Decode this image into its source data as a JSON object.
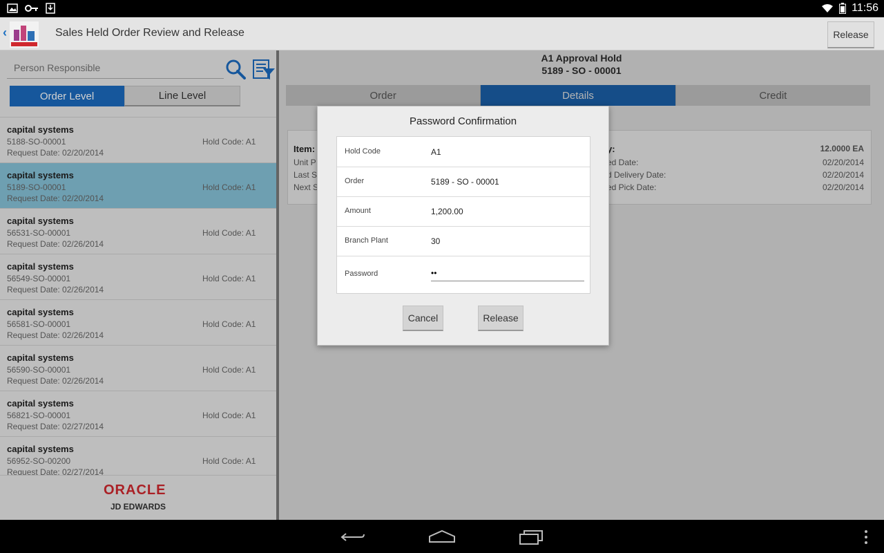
{
  "status_bar": {
    "time": "11:56"
  },
  "header": {
    "title": "Sales Held Order Review and Release",
    "release_label": "Release"
  },
  "left": {
    "search": {
      "placeholder": "Person Responsible",
      "value": ""
    },
    "segments": [
      {
        "label": "Order Level",
        "selected": true
      },
      {
        "label": "Line Level",
        "selected": false
      }
    ],
    "orders": [
      {
        "name": "capital systems",
        "order": "5188-SO-00001",
        "date": "Request Date: 02/20/2014",
        "hold": "Hold Code: A1"
      },
      {
        "name": "capital systems",
        "order": "5189-SO-00001",
        "date": "Request Date: 02/20/2014",
        "hold": "Hold Code: A1",
        "selected": true
      },
      {
        "name": "capital systems",
        "order": "56531-SO-00001",
        "date": "Request Date: 02/26/2014",
        "hold": "Hold Code: A1"
      },
      {
        "name": "capital systems",
        "order": "56549-SO-00001",
        "date": "Request Date: 02/26/2014",
        "hold": "Hold Code: A1"
      },
      {
        "name": "capital systems",
        "order": "56581-SO-00001",
        "date": "Request Date: 02/26/2014",
        "hold": "Hold Code: A1"
      },
      {
        "name": "capital systems",
        "order": "56590-SO-00001",
        "date": "Request Date: 02/26/2014",
        "hold": "Hold Code: A1"
      },
      {
        "name": "capital systems",
        "order": "56821-SO-00001",
        "date": "Request Date: 02/27/2014",
        "hold": "Hold Code: A1"
      },
      {
        "name": "capital systems",
        "order": "56952-SO-00200",
        "date": "Request Date: 02/27/2014",
        "hold": "Hold Code: A1"
      }
    ],
    "footer": {
      "brand": "ORACLE",
      "sub": "JD EDWARDS"
    }
  },
  "right": {
    "title_line1": "A1 Approval Hold",
    "title_line2": "5189 - SO - 00001",
    "tabs": [
      {
        "label": "Order"
      },
      {
        "label": "Details",
        "active": true
      },
      {
        "label": "Credit"
      }
    ],
    "card": {
      "item_label": "Item:",
      "unit_label": "Unit P",
      "last_label": "Last S",
      "next_label": "Next S",
      "qty_label": "y:",
      "qty_value": "12.0000 EA",
      "d1_label": "ed Date:",
      "d1_value": "02/20/2014",
      "d2_label": "d Delivery Date:",
      "d2_value": "02/20/2014",
      "d3_label": "ed Pick Date:",
      "d3_value": "02/20/2014"
    }
  },
  "dialog": {
    "title": "Password Confirmation",
    "fields": [
      {
        "label": "Hold Code",
        "value": "A1"
      },
      {
        "label": "Order",
        "value": "5189 - SO - 00001"
      },
      {
        "label": "Amount",
        "value": "1,200.00"
      },
      {
        "label": "Branch Plant",
        "value": "30"
      }
    ],
    "password_label": "Password",
    "password_value": "••",
    "cancel_label": "Cancel",
    "release_label": "Release"
  }
}
